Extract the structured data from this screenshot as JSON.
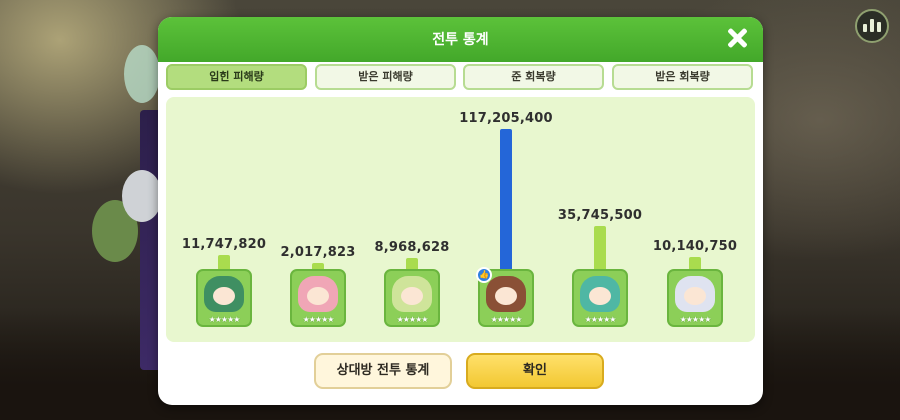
{
  "dialog": {
    "title": "전투 통계"
  },
  "tabs": [
    {
      "label": "입힌 피해량",
      "active": true
    },
    {
      "label": "받은 피해량",
      "active": false
    },
    {
      "label": "준 회복량",
      "active": false
    },
    {
      "label": "받은 회복량",
      "active": false
    }
  ],
  "buttons": {
    "opponent_stats": "상대방 전투 통계",
    "confirm": "확인"
  },
  "colors": {
    "bar_default": "#a9dc4e",
    "bar_highlight": "#2466d8",
    "header": "#4fb531"
  },
  "characters": [
    {
      "name": "green-haired character",
      "label": "11,747,820",
      "value": 11747820,
      "hair": "#3f8f62",
      "star_count": 5,
      "mvp": false
    },
    {
      "name": "pink-haired character",
      "label": "2,017,823",
      "value": 2017823,
      "hair": "#f0a6b6",
      "star_count": 5,
      "mvp": false
    },
    {
      "name": "yellow-hat character",
      "label": "8,968,628",
      "value": 8968628,
      "hair": "#cfe49a",
      "star_count": 5,
      "mvp": false
    },
    {
      "name": "brown-haired character",
      "label": "117,205,400",
      "value": 117205400,
      "hair": "#8a5036",
      "star_count": 5,
      "mvp": true
    },
    {
      "name": "teal-haired character",
      "label": "35,745,500",
      "value": 35745500,
      "hair": "#4fb7a4",
      "star_count": 5,
      "mvp": false
    },
    {
      "name": "silver-haired character",
      "label": "10,140,750",
      "value": 10140750,
      "hair": "#dfe3f0",
      "star_count": 5,
      "mvp": false
    }
  ],
  "chart_data": {
    "type": "bar",
    "categories": [
      "green-haired character",
      "pink-haired character",
      "yellow-hat character",
      "brown-haired character",
      "teal-haired character",
      "silver-haired character"
    ],
    "values": [
      11747820,
      2017823,
      8968628,
      117205400,
      35745500,
      10140750
    ],
    "title": "",
    "xlabel": "",
    "ylabel": ""
  }
}
